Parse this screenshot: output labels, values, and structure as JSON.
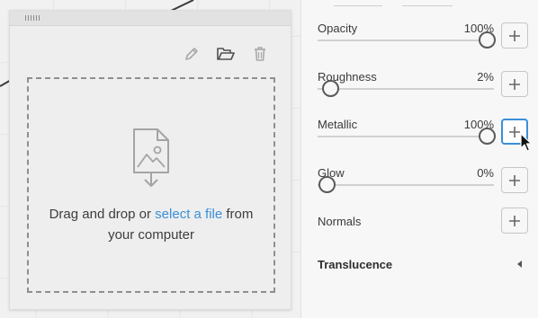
{
  "upload": {
    "drop_text_before": "Drag and drop or ",
    "drop_link": "select a file",
    "drop_text_after": " from",
    "drop_text_line2": "your computer"
  },
  "tools": {
    "edit_icon": "pencil-icon",
    "open_icon": "folder-open-icon",
    "delete_icon": "trash-icon"
  },
  "properties": [
    {
      "label": "Opacity",
      "value": "100%",
      "level": 1.0
    },
    {
      "label": "Roughness",
      "value": "2%",
      "level": 0.02
    },
    {
      "label": "Metallic",
      "value": "100%",
      "level": 1.0
    },
    {
      "label": "Glow",
      "value": "0%",
      "level": 0.0
    }
  ],
  "normals": {
    "label": "Normals"
  },
  "translucence": {
    "label": "Translucence"
  },
  "colors": {
    "accent": "#3a8fd9",
    "panel": "#f7f7f7"
  }
}
